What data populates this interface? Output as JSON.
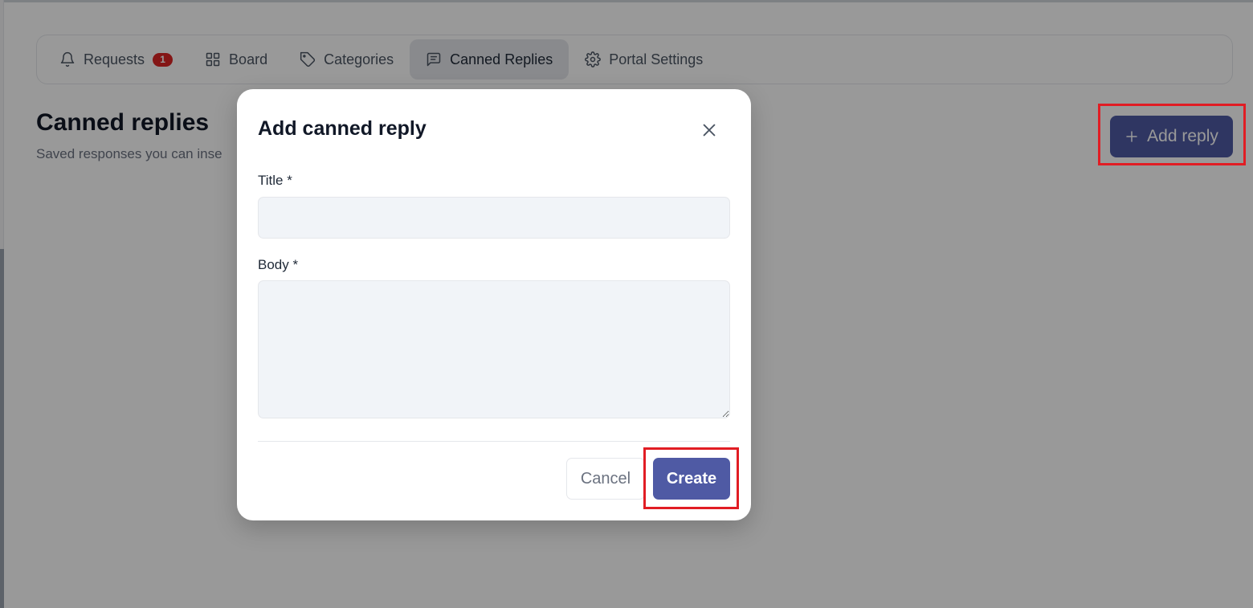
{
  "tabs": [
    {
      "label": "Requests",
      "icon": "bell-icon",
      "badge": "1"
    },
    {
      "label": "Board",
      "icon": "grid-icon"
    },
    {
      "label": "Categories",
      "icon": "tag-icon"
    },
    {
      "label": "Canned Replies",
      "icon": "message-square-icon",
      "active": true
    },
    {
      "label": "Portal Settings",
      "icon": "gear-icon"
    }
  ],
  "page": {
    "title": "Canned replies",
    "subtitle": "Saved responses you can inse"
  },
  "header": {
    "add_reply_label": "Add reply",
    "add_reply_icon": "plus-icon"
  },
  "modal": {
    "title": "Add canned reply",
    "title_field_label": "Title *",
    "title_field_value": "",
    "body_field_label": "Body *",
    "body_field_value": "",
    "cancel_label": "Cancel",
    "create_label": "Create"
  },
  "colors": {
    "primary": "#4f5aa4",
    "badge": "#dc2626",
    "highlight": "#e11d24",
    "overlay": "rgba(0,0,0,0.4)"
  }
}
